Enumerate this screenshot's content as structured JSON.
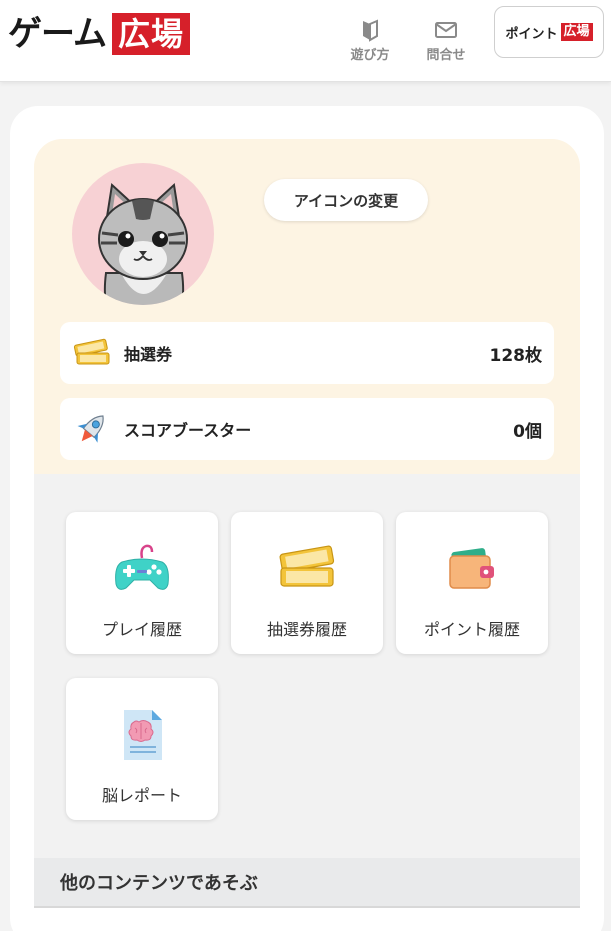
{
  "header": {
    "logo_main": "ゲーム",
    "logo_box": "広場",
    "nav": [
      {
        "label": "遊び方",
        "icon": "beginner-mark-icon"
      },
      {
        "label": "問合せ",
        "icon": "mail-icon"
      }
    ],
    "point_button": {
      "text": "ポイント",
      "box": "広場"
    }
  },
  "profile": {
    "avatar_icon": "cat-avatar-icon",
    "change_icon_label": "アイコンの変更",
    "stats": [
      {
        "label": "抽選券",
        "value": "128枚",
        "icon": "ticket-icon"
      },
      {
        "label": "スコアブースター",
        "value": "0個",
        "icon": "rocket-icon"
      }
    ]
  },
  "menu": [
    {
      "label": "プレイ履歴",
      "icon": "gamepad-icon"
    },
    {
      "label": "抽選券履歴",
      "icon": "tickets-icon"
    },
    {
      "label": "ポイント履歴",
      "icon": "wallet-icon"
    },
    {
      "label": "脳レポート",
      "icon": "brain-report-icon"
    }
  ],
  "other_section": {
    "title": "他のコンテンツであそぶ"
  },
  "colors": {
    "brand_red": "#d6202a",
    "profile_bg": "#fdf4e3",
    "avatar_bg": "#f7d1d4"
  }
}
